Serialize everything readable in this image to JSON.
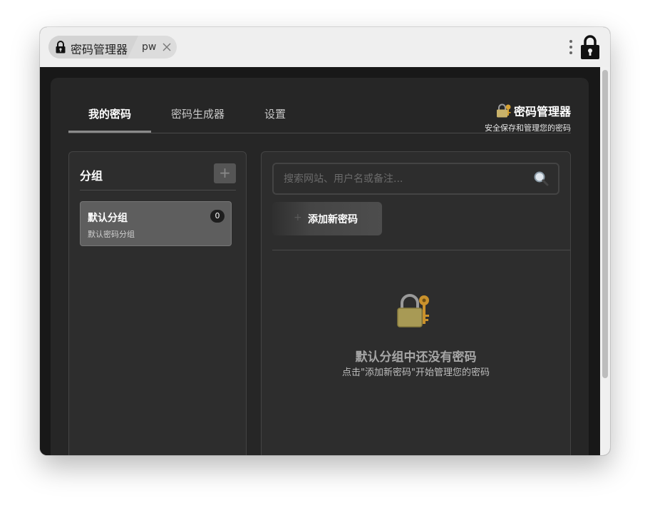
{
  "browser": {
    "tab_title": "密码管理器",
    "tab2_title": "pw",
    "icons": {
      "tab": "lock-icon",
      "close": "close-icon",
      "menu": "kebab-menu-icon",
      "extension": "lock-icon"
    }
  },
  "nav": {
    "tabs": [
      {
        "label": "我的密码",
        "active": true
      },
      {
        "label": "密码生成器",
        "active": false
      },
      {
        "label": "设置",
        "active": false
      }
    ],
    "brand_title": "密码管理器",
    "brand_subtitle": "安全保存和管理您的密码",
    "brand_icon": "lock-with-key-icon"
  },
  "groups": {
    "title": "分组",
    "add_label": "+",
    "items": [
      {
        "name": "默认分组",
        "description": "默认密码分组",
        "count": "0"
      }
    ]
  },
  "main": {
    "search_placeholder": "搜索网站、用户名或备注...",
    "search_icon": "magnifier-icon",
    "add_button_plus": "+",
    "add_button_label": "添加新密码",
    "empty_icon": "lock-with-key-icon",
    "empty_title": "默认分组中还没有密码",
    "empty_subtitle": "点击\"添加新密码\"开始管理您的密码"
  },
  "colors": {
    "background": "#181818",
    "card": "#262626",
    "panel": "#2d2d2d",
    "selected_item": "#5e5e5e",
    "accent_underline": "#8a8a8a"
  }
}
